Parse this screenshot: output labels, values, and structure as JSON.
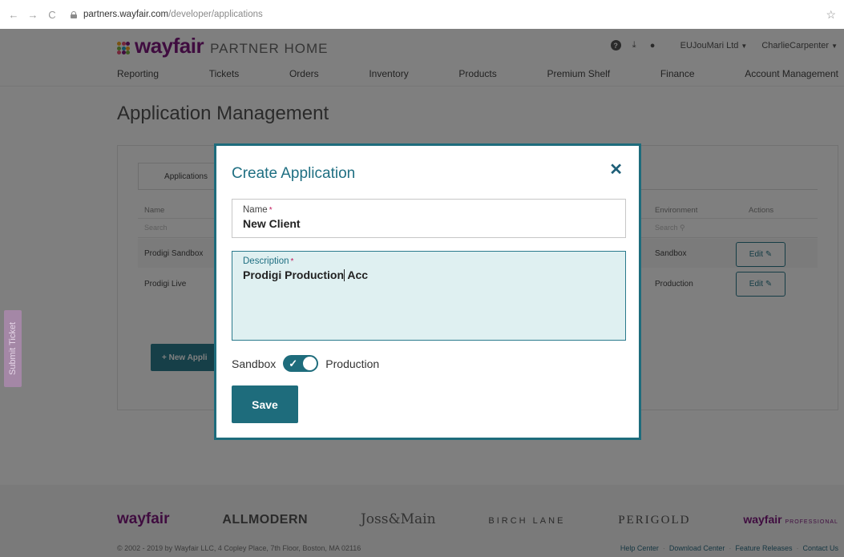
{
  "browser": {
    "back": "←",
    "forward": "→",
    "reload": "C",
    "url_host": "partners.wayfair.com",
    "url_path": "/developer/applications",
    "bookmark": "☆"
  },
  "header": {
    "logo": "wayfair",
    "logo_subtitle": "PARTNER HOME",
    "account": "EUJouMari Ltd",
    "user": "CharlieCarpenter",
    "nav": [
      "Reporting",
      "Tickets",
      "Orders",
      "Inventory",
      "Products",
      "Premium Shelf",
      "Finance",
      "Account Management"
    ]
  },
  "page": {
    "title": "Application Management",
    "tab_label": "Applications",
    "columns": {
      "name": "Name",
      "environment": "Environment",
      "actions": "Actions"
    },
    "search_placeholder": "Search",
    "rows": [
      {
        "name": "Prodigi Sandbox",
        "environment": "Sandbox",
        "action": "Edit"
      },
      {
        "name": "Prodigi Live",
        "environment": "Production",
        "action": "Edit"
      }
    ],
    "new_app_button": "+ New Appli"
  },
  "side_tab": "Submit Ticket",
  "modal": {
    "title": "Create Application",
    "name_label": "Name",
    "name_value": "New Client",
    "description_label": "Description",
    "description_value_before_caret": "Prodigi Production",
    "description_value_after_caret": " Acc",
    "required_marker": "*",
    "toggle_left": "Sandbox",
    "toggle_right": "Production",
    "save": "Save"
  },
  "footer": {
    "brands": {
      "wayfair": "wayfair",
      "allmodern": "ALLMODERN",
      "joss": "Joss&Main",
      "birch": "BIRCH LANE",
      "perigold": "PERIGOLD",
      "pro": "wayfair",
      "pro_suffix": "PROFESSIONAL"
    },
    "copyright": "© 2002 - 2019 by Wayfair LLC, 4 Copley Place, 7th Floor, Boston, MA 02116",
    "links": [
      "Help Center",
      "Download Center",
      "Feature Releases",
      "Contact Us"
    ]
  },
  "colors": {
    "brand_purple": "#7f187f",
    "accent_teal": "#1e6c7c"
  }
}
